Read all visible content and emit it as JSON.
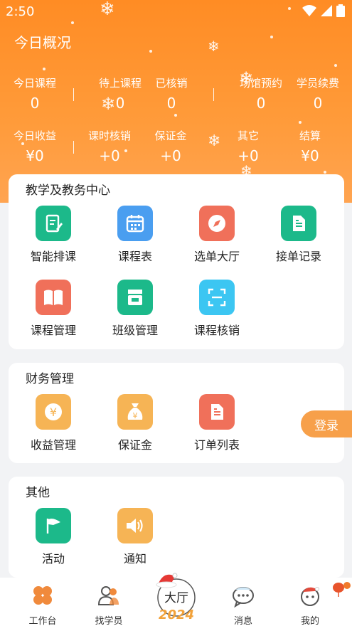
{
  "status_bar": {
    "time": "2:50"
  },
  "header": {
    "title": "今日概况",
    "row1": [
      {
        "label": "今日课程",
        "value": "0"
      },
      {
        "label": "待上课程",
        "value": "0"
      },
      {
        "label": "已核销",
        "value": "0"
      },
      {
        "label": "场馆预约",
        "value": "0"
      },
      {
        "label": "学员续费",
        "value": "0"
      }
    ],
    "row2": [
      {
        "label": "今日收益",
        "value": "¥0"
      },
      {
        "label": "课时核销",
        "value": "+0"
      },
      {
        "label": "保证金",
        "value": "+0"
      },
      {
        "label": "其它",
        "value": "+0"
      },
      {
        "label": "结算",
        "value": "¥0"
      }
    ]
  },
  "teaching": {
    "title": "教学及教务中心",
    "items": [
      {
        "label": "智能排课",
        "icon": "edit-document-icon",
        "color": "#1cb98a"
      },
      {
        "label": "课程表",
        "icon": "calendar-icon",
        "color": "#4a9ef0"
      },
      {
        "label": "选单大厅",
        "icon": "compass-icon",
        "color": "#f0705a"
      },
      {
        "label": "接单记录",
        "icon": "document-icon",
        "color": "#1cb98a"
      },
      {
        "label": "课程管理",
        "icon": "book-icon",
        "color": "#f0705a"
      },
      {
        "label": "班级管理",
        "icon": "class-box-icon",
        "color": "#1cb98a"
      },
      {
        "label": "课程核销",
        "icon": "scan-icon",
        "color": "#3cc6f2"
      }
    ]
  },
  "finance": {
    "title": "财务管理",
    "items": [
      {
        "label": "收益管理",
        "icon": "yuan-coin-icon",
        "color": "#f6b455"
      },
      {
        "label": "保证金",
        "icon": "money-bag-icon",
        "color": "#f6b455"
      },
      {
        "label": "订单列表",
        "icon": "order-list-icon",
        "color": "#f0705a"
      }
    ]
  },
  "other": {
    "title": "其他",
    "items": [
      {
        "label": "活动",
        "icon": "flag-icon",
        "color": "#1cb98a"
      },
      {
        "label": "通知",
        "icon": "speaker-icon",
        "color": "#f6b455"
      }
    ]
  },
  "login_button": "登录",
  "tabbar": {
    "items": [
      {
        "label": "工作台",
        "icon": "workbench-icon"
      },
      {
        "label": "找学员",
        "icon": "students-icon"
      },
      {
        "label": "消息",
        "icon": "message-icon"
      },
      {
        "label": "我的",
        "icon": "profile-icon"
      }
    ],
    "center": {
      "label": "大厅",
      "year": "2024"
    }
  }
}
